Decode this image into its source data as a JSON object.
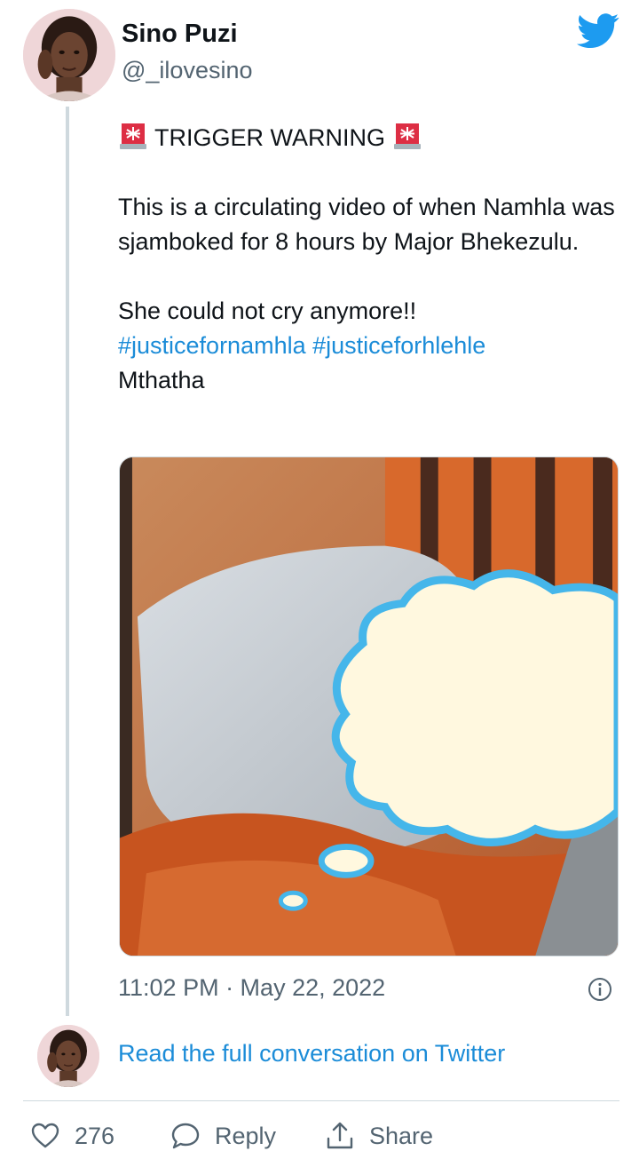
{
  "author": {
    "display_name": "Sino Puzi",
    "handle": "@_ilovesino"
  },
  "icons": {
    "brand": "twitter-bird-icon",
    "siren": "police-light-emoji",
    "info": "info-icon",
    "like": "heart-icon",
    "reply": "reply-bubble-icon",
    "share": "share-icon"
  },
  "colors": {
    "brand_blue": "#1d9bf0",
    "link": "#1b8cd8",
    "muted": "#536471",
    "text": "#0f1419"
  },
  "tweet": {
    "warning_label": "TRIGGER WARNING",
    "paragraph1": "This is a circulating video of when Namhla was sjamboked for 8 hours by Major Bhekezulu.",
    "paragraph2": "She could not cry anymore!!",
    "hashtags": [
      "#justicefornamhla",
      "#justiceforhlehle"
    ],
    "location_line": "Mthatha",
    "timestamp": "11:02 PM · May 22, 2022"
  },
  "conversation": {
    "link_text": "Read the full conversation on Twitter"
  },
  "actions": {
    "like_count": "276",
    "reply_label": "Reply",
    "share_label": "Share"
  }
}
